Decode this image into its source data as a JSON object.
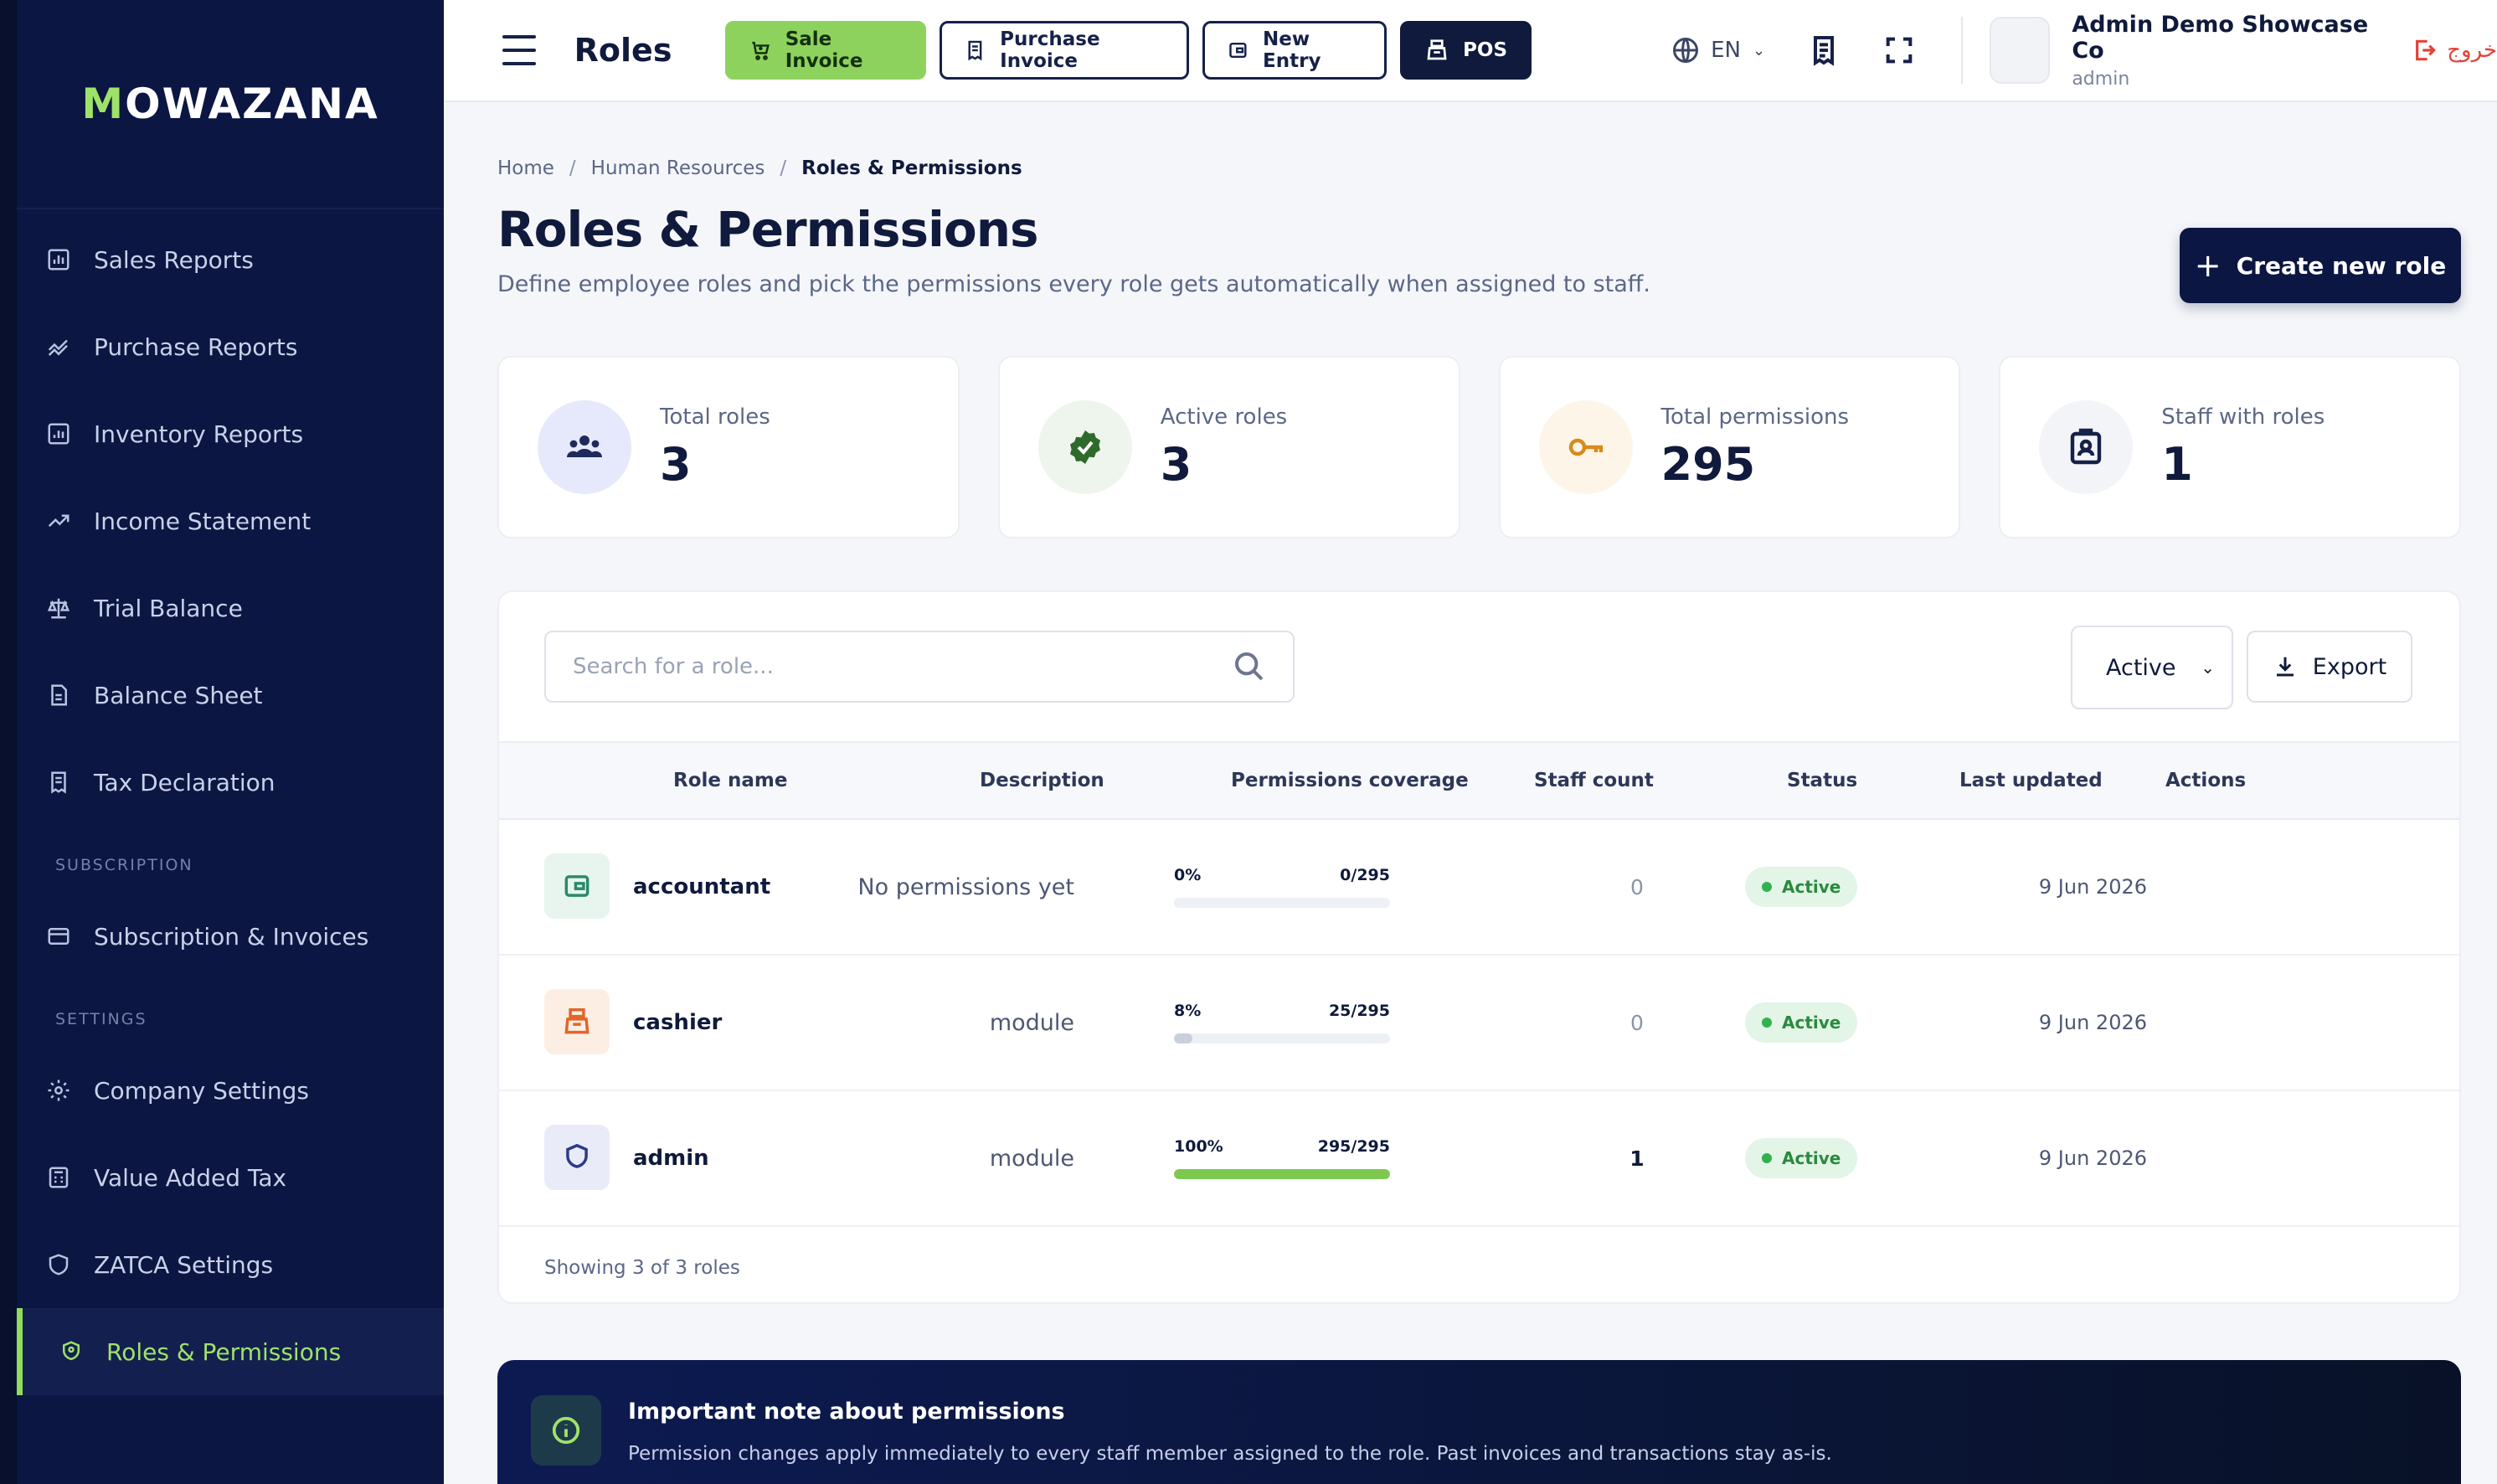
{
  "brand": {
    "logo_text_a": "M",
    "logo_text_b": "OWAZANA"
  },
  "sidebar": {
    "items": [
      {
        "label": "Sales Reports",
        "icon": "bar-chart-icon"
      },
      {
        "label": "Purchase Reports",
        "icon": "trend-lines-icon"
      },
      {
        "label": "Inventory Reports",
        "icon": "bar-chart-icon"
      },
      {
        "label": "Income Statement",
        "icon": "trend-up-icon"
      },
      {
        "label": "Trial Balance",
        "icon": "scale-icon"
      },
      {
        "label": "Balance Sheet",
        "icon": "document-icon"
      },
      {
        "label": "Tax Declaration",
        "icon": "receipt-icon"
      }
    ],
    "section_subscription": "SUBSCRIPTION",
    "subscription_items": [
      {
        "label": "Subscription & Invoices",
        "icon": "credit-card-icon"
      }
    ],
    "section_settings": "SETTINGS",
    "settings_items": [
      {
        "label": "Company Settings",
        "icon": "gear-icon"
      },
      {
        "label": "Value Added Tax",
        "icon": "calculator-icon"
      },
      {
        "label": "ZATCA Settings",
        "icon": "shield-icon"
      },
      {
        "label": "Roles & Permissions",
        "icon": "user-lock-icon",
        "active": true
      }
    ]
  },
  "topbar": {
    "title": "Roles",
    "quick_actions": {
      "sale_invoice": "Sale Invoice",
      "purchase_invoice": "Purchase Invoice",
      "new_entry": "New Entry",
      "pos": "POS"
    },
    "language": "EN",
    "user_name": "Admin Demo Showcase Co",
    "user_role": "admin",
    "logout_label": "خروج"
  },
  "page": {
    "breadcrumb": {
      "home": "Home",
      "section": "Human Resources",
      "current": "Roles & Permissions",
      "separator": "/"
    },
    "title": "Roles & Permissions",
    "subtitle": "Define employee roles and pick the permissions every role gets automatically when assigned to staff.",
    "create_button": "Create new role",
    "create_button_plus": "+"
  },
  "stats": [
    {
      "label": "Total roles",
      "value": "3"
    },
    {
      "label": "Active roles",
      "value": "3"
    },
    {
      "label": "Total permissions",
      "value": "295"
    },
    {
      "label": "Staff with roles",
      "value": "1"
    }
  ],
  "table": {
    "search_placeholder": "Search for a role...",
    "filter_value": "Active",
    "export_label": "Export",
    "columns": {
      "role_name": "Role name",
      "description": "Description",
      "coverage": "Permissions coverage",
      "staff": "Staff count",
      "status": "Status",
      "updated": "Last updated",
      "actions": "Actions"
    },
    "rows": [
      {
        "name": "accountant",
        "description": "No permissions yet",
        "percent": "0%",
        "ratio": "0/295",
        "fraction": 0.0,
        "staff": "0",
        "status": "Active",
        "updated": "9 Jun 2026"
      },
      {
        "name": "cashier",
        "description": "module",
        "percent": "8%",
        "ratio": "25/295",
        "fraction": 0.085,
        "staff": "0",
        "status": "Active",
        "updated": "9 Jun 2026"
      },
      {
        "name": "admin",
        "description": "module",
        "percent": "100%",
        "ratio": "295/295",
        "fraction": 1.0,
        "staff": "1",
        "status": "Active",
        "updated": "9 Jun 2026"
      }
    ],
    "footer": "Showing 3 of 3 roles"
  },
  "note": {
    "title": "Important note about permissions",
    "body": "Permission changes apply immediately to every staff member assigned to the role. Past invoices and transactions stay as-is."
  },
  "colors": {
    "accent_green": "#8ed25e",
    "navy": "#0b1642",
    "status_green": "#31b24f",
    "bar_full": "#7dc94f",
    "bar_partial": "#c9cfdb"
  }
}
